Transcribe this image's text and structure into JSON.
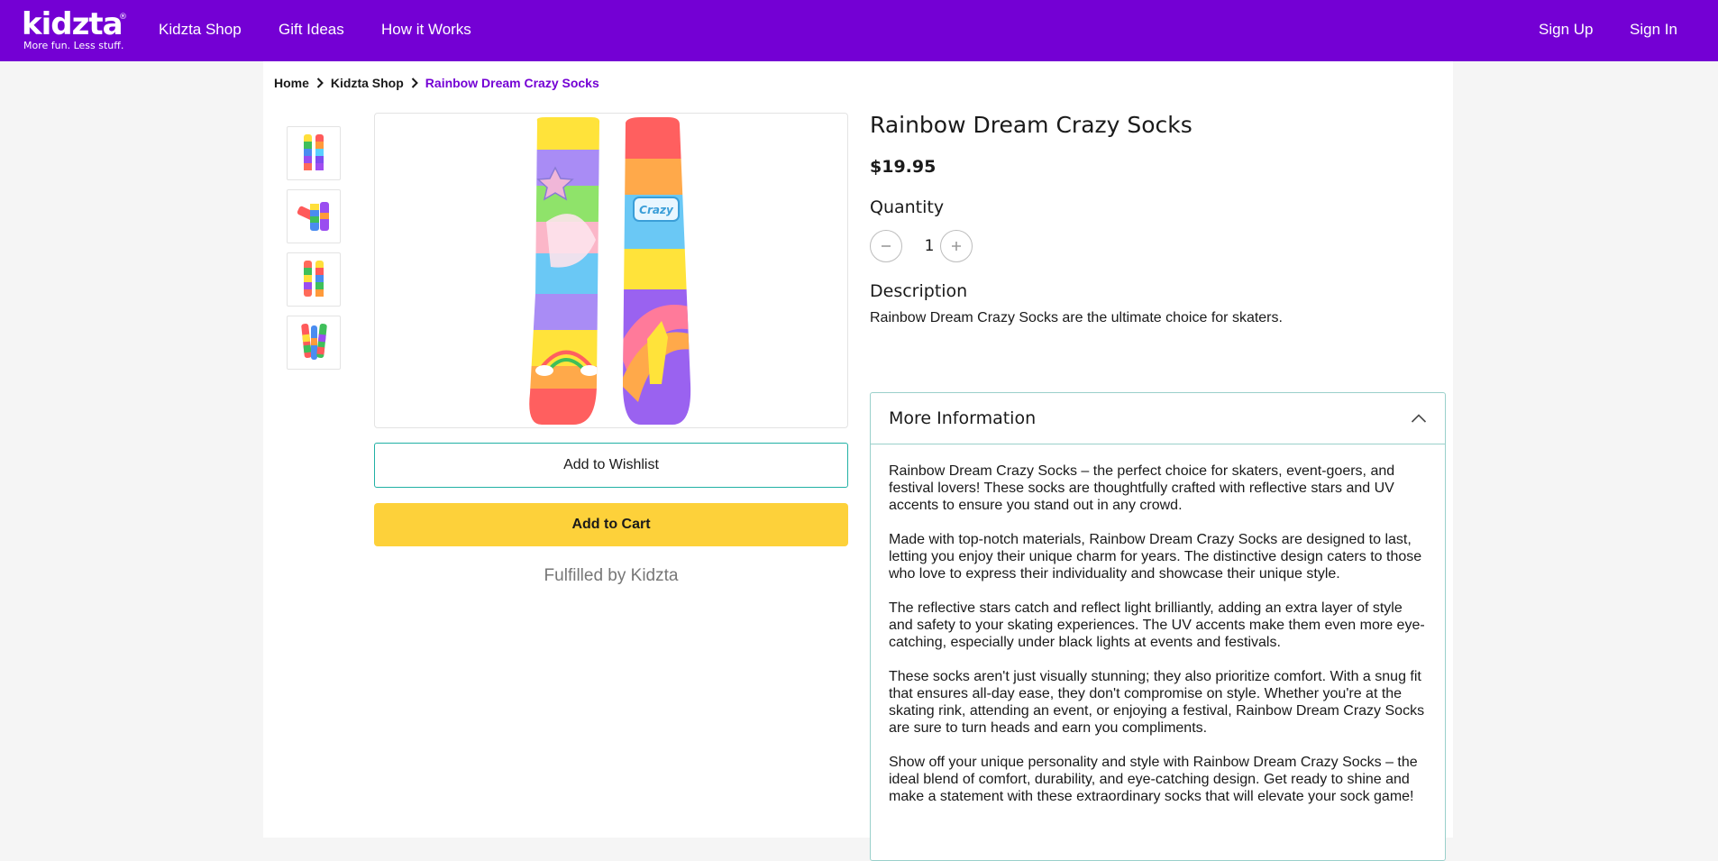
{
  "header": {
    "logo_text": "kidzta",
    "logo_mark": "®",
    "tagline": "More fun. Less stuff.",
    "nav": [
      "Kidzta Shop",
      "Gift Ideas",
      "How it Works"
    ],
    "sign_up": "Sign Up",
    "sign_in": "Sign In",
    "brand_color": "#7400d4"
  },
  "breadcrumb": {
    "items": [
      "Home",
      "Kidzta Shop",
      "Rainbow Dream Crazy Socks"
    ]
  },
  "gallery": {
    "thumbnails": [
      "socks-front-view",
      "socks-folded-view",
      "socks-back-view",
      "socks-side-view"
    ]
  },
  "actions": {
    "wishlist": "Add to Wishlist",
    "cart": "Add to Cart",
    "fulfilled": "Fulfilled by Kidzta"
  },
  "product": {
    "title": "Rainbow Dream Crazy Socks",
    "price": "$19.95",
    "quantity_label": "Quantity",
    "quantity": "1",
    "description_label": "Description",
    "description": "Rainbow Dream Crazy Socks are the ultimate choice for skaters."
  },
  "more_info": {
    "title": "More Information",
    "paragraphs": [
      "Rainbow Dream Crazy Socks – the perfect choice for skaters, event-goers, and festival lovers! These socks are thoughtfully crafted with reflective stars and UV accents to ensure you stand out in any crowd.",
      "Made with top-notch materials, Rainbow Dream Crazy Socks are designed to last, letting you enjoy their unique charm for years. The distinctive design caters to those who love to express their individuality and showcase their unique style.",
      "The reflective stars catch and reflect light brilliantly, adding an extra layer of style and safety to your skating experiences. The UV accents make them even more eye-catching, especially under black lights at events and festivals.",
      "These socks aren't just visually stunning; they also prioritize comfort. With a snug fit that ensures all-day ease, they don't compromise on style. Whether you're at the skating rink, attending an event, or enjoying a festival, Rainbow Dream Crazy Socks are sure to turn heads and earn you compliments.",
      "Show off your unique personality and style with Rainbow Dream Crazy Socks – the ideal blend of comfort, durability, and eye-catching design. Get ready to shine and make a statement with these extraordinary socks that will elevate your sock game!"
    ]
  }
}
